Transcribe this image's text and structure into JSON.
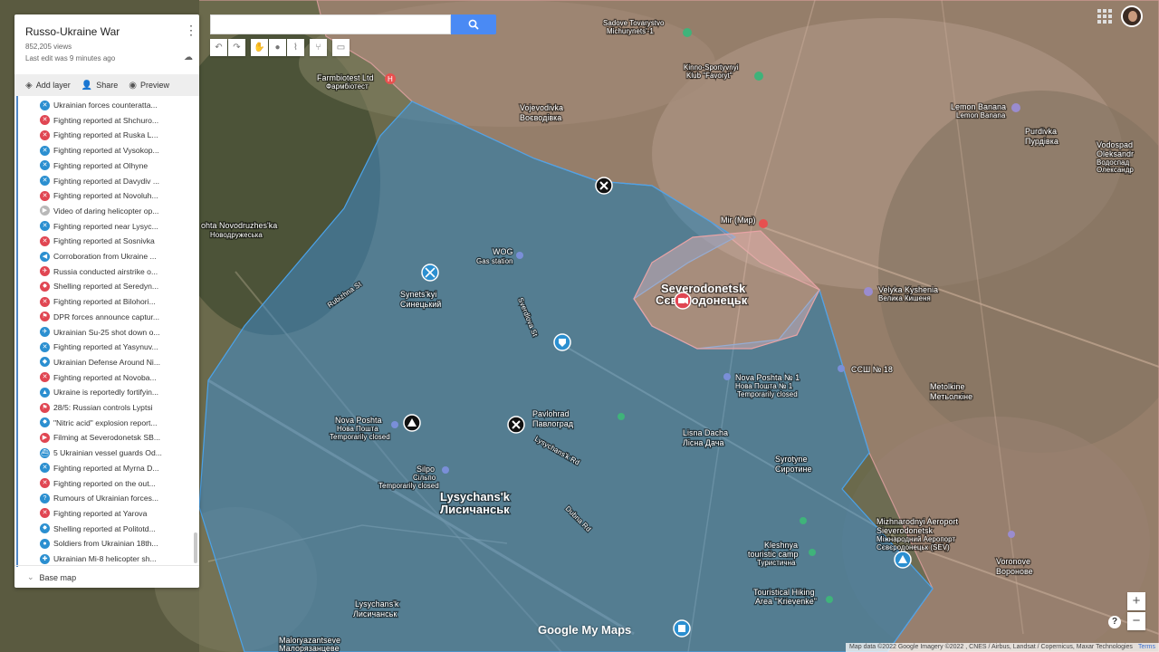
{
  "map_title": "Russo-Ukraine War",
  "views": "852,205 views",
  "last_edit": "Last edit was 9 minutes ago",
  "toolbar": {
    "add_layer": "Add layer",
    "share": "Share",
    "preview": "Preview"
  },
  "items": [
    {
      "label": "Ukrainian forces counteratta...",
      "color": "#2b8fd0",
      "icon": "crossed-swords-icon"
    },
    {
      "label": "Fighting reported at Shchuro...",
      "color": "#e04652",
      "icon": "crossed-swords-icon"
    },
    {
      "label": "Fighting reported at Ruska L...",
      "color": "#e04652",
      "icon": "crossed-swords-icon"
    },
    {
      "label": "Fighting reported at Vysokop...",
      "color": "#2b8fd0",
      "icon": "crossed-swords-icon"
    },
    {
      "label": "Fighting reported at Olhyne",
      "color": "#2b8fd0",
      "icon": "crossed-swords-icon"
    },
    {
      "label": "Fighting reported at Davydiv ...",
      "color": "#2b8fd0",
      "icon": "crossed-swords-icon"
    },
    {
      "label": "Fighting reported at Novoluh...",
      "color": "#e04652",
      "icon": "crossed-swords-icon"
    },
    {
      "label": "Video of daring helicopter op...",
      "color": "#b8b8b8",
      "icon": "video-icon"
    },
    {
      "label": "Fighting reported near Lysyc...",
      "color": "#2b8fd0",
      "icon": "crossed-swords-icon"
    },
    {
      "label": "Fighting reported at Sosnivka",
      "color": "#e04652",
      "icon": "crossed-swords-icon"
    },
    {
      "label": "Corroboration from Ukraine ...",
      "color": "#2b8fd0",
      "icon": "megaphone-icon"
    },
    {
      "label": "Russia conducted airstrike o...",
      "color": "#e04652",
      "icon": "plane-icon"
    },
    {
      "label": "Shelling reported at Seredyn...",
      "color": "#e04652",
      "icon": "explosion-icon"
    },
    {
      "label": "Fighting reported at Bilohori...",
      "color": "#e04652",
      "icon": "crossed-swords-icon"
    },
    {
      "label": "DPR forces announce captur...",
      "color": "#e04652",
      "icon": "flag-icon"
    },
    {
      "label": "Ukrainian Su-25 shot down o...",
      "color": "#2b8fd0",
      "icon": "plane-icon"
    },
    {
      "label": "Fighting reported at Yasynuv...",
      "color": "#2b8fd0",
      "icon": "crossed-swords-icon"
    },
    {
      "label": "Ukrainian Defense Around Ni...",
      "color": "#2b8fd0",
      "icon": "shield-icon"
    },
    {
      "label": "Fighting reported at Novoba...",
      "color": "#e04652",
      "icon": "crossed-swords-icon"
    },
    {
      "label": "Ukraine is reportedly fortifyin...",
      "color": "#2b8fd0",
      "icon": "triangle-icon"
    },
    {
      "label": "28/5: Russian controls Lyptsi",
      "color": "#e04652",
      "icon": "flag-icon"
    },
    {
      "label": "\"Nitric acid\" explosion report...",
      "color": "#2b8fd0",
      "icon": "explosion-icon"
    },
    {
      "label": "Filming at Severodonetsk SB...",
      "color": "#e04652",
      "icon": "video-icon"
    },
    {
      "label": "5 Ukrainian vessel guards Od...",
      "color": "#2b8fd0",
      "icon": "ship-icon"
    },
    {
      "label": "Fighting reported at Myrna D...",
      "color": "#2b8fd0",
      "icon": "crossed-swords-icon"
    },
    {
      "label": "Fighting reported on the out...",
      "color": "#e04652",
      "icon": "crossed-swords-icon"
    },
    {
      "label": "Rumours of Ukrainian forces...",
      "color": "#2b8fd0",
      "icon": "question-icon"
    },
    {
      "label": "Fighting reported at Yarova",
      "color": "#e04652",
      "icon": "crossed-swords-icon"
    },
    {
      "label": "Shelling reported at Politotd...",
      "color": "#2b8fd0",
      "icon": "explosion-icon"
    },
    {
      "label": "Soldiers from Ukrainian 18th...",
      "color": "#2b8fd0",
      "icon": "soldier-icon"
    },
    {
      "label": "Ukrainian Mi-8 helicopter sh...",
      "color": "#2b8fd0",
      "icon": "helicopter-icon"
    }
  ],
  "base_map": "Base map",
  "search": {
    "value": "",
    "placeholder": ""
  },
  "places": {
    "severodonetsk": "Severodonetsk",
    "severodonetsk_uk": "Сєвєродонецьк",
    "lysychansk": "Lysychans'k",
    "lysychansk_uk": "Лисичанськ",
    "pavlohrad": "Pavlohrad",
    "pavlohrad_uk": "Павлоград",
    "synetskyi": "Synets'kyi",
    "synetskyi_uk": "Синецький",
    "wog": "WOG",
    "gas_station": "Gas station",
    "vojevodivka": "Vojevodivka",
    "vojevodivka_uk": "Воєводівка",
    "velyka": "Velyka Kyshenia",
    "velyka_uk": "Велика Кишеня",
    "metolkine": "Metolkine",
    "metolkine_uk": "Метьолкіне",
    "syrotyne": "Syrotyne",
    "syrotyne_uk": "Сиротине",
    "lisna": "Lisna Dacha",
    "lisna_uk": "Лісна Дача",
    "voronove": "Voronove",
    "voronove_uk": "Воронове",
    "purdivka": "Purdivka",
    "purdivka_uk": "Пурдівка",
    "lemon": "Lemon Banana",
    "lemon_uk": "Lemon Banana",
    "farmbiotest": "Farmbiotest Ltd",
    "farmbiotest_uk": "Фармбіотест",
    "sadove": "Sadove Tovarystvo",
    "sadove2": "Michurynets'-1",
    "kinno": "Kinno-Sportyvnyi",
    "kinno2": "Klub \"Favoryt\"",
    "novodruzh": "ohta Novodruzhes'ka",
    "novodruzh_uk": "Новодружеська",
    "mir": "Mir (Мир)",
    "nova_poshta": "Nova Poshta",
    "nova_poshta_uk": "Нова Пошта",
    "temporarily": "Temporarily closed",
    "silpo": "Silpo",
    "silpo_uk": "Сільпо",
    "airport": "Mizhnarodnyi Aeroport",
    "airport2": "Sieverodonetsk",
    "airport_uk": "Міжнародний Аеропорт",
    "airport_uk2": "Сєвєродонецьк (SEV)",
    "kleshnya": "Kleshnya",
    "kleshnya2": "touristic camp",
    "kleshnya_uk": "Туристична",
    "hiking": "Touristical Hiking",
    "hiking2": "Area \"Krievenke\"",
    "nova_poshta2": "Nova Poshta № 1",
    "nova_poshta2_uk": "Нова Пошта № 1",
    "lysychansk2": "Lysychans'k",
    "lysychansk2_uk": "Лисичанськ",
    "malorya": "Maloryazantseve",
    "malorya_uk": "Малорязанцеве",
    "vodos": "Vodospad",
    "vodos2": "Oleksandr",
    "vodos_uk": "Водоспад",
    "vodos_uk2": "Олександр",
    "school": "ССШ № 18",
    "street1": "Rubizhna St",
    "street2": "Sverdlova St",
    "street3": "Lysychans'k Rd",
    "street4": "Dubna Rd"
  },
  "map_logo": "Google My Maps",
  "attribution": "Map data ©2022 Google Imagery ©2022 , CNES / Airbus, Landsat / Copernicus, Maxar Technologies",
  "terms": "Terms",
  "zoom_in": "+",
  "zoom_out": "−",
  "help": "?",
  "colors": {
    "ukraine_area": "#3d8fd6",
    "russia_area": "#e5a3a4",
    "city_fill": "#f2b8b8",
    "panel_rule": "#4f86c6",
    "search_button": "#4a8af4"
  }
}
